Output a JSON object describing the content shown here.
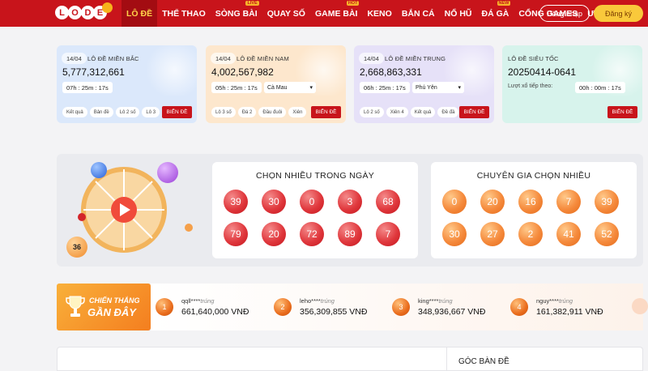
{
  "nav": {
    "logo_letters": [
      "L",
      "O",
      "D",
      "E"
    ],
    "items": [
      {
        "label": "LÔ ĐỀ",
        "active": true,
        "tag": ""
      },
      {
        "label": "THỂ THAO",
        "active": false,
        "tag": ""
      },
      {
        "label": "SÒNG BÀI",
        "active": false,
        "tag": "LIVE"
      },
      {
        "label": "QUAY SỐ",
        "active": false,
        "tag": ""
      },
      {
        "label": "GAME BÀI",
        "active": false,
        "tag": "HOT"
      },
      {
        "label": "KENO",
        "active": false,
        "tag": ""
      },
      {
        "label": "BẮN CÁ",
        "active": false,
        "tag": ""
      },
      {
        "label": "NỔ HŨ",
        "active": false,
        "tag": ""
      },
      {
        "label": "ĐÁ GÀ",
        "active": false,
        "tag": "NEW"
      },
      {
        "label": "CỔNG GAMES",
        "active": false,
        "tag": ""
      },
      {
        "label": "ƯU ĐÃI",
        "active": false,
        "tag": ""
      }
    ],
    "login_label": "Đăng nhập",
    "register_label": "Đăng ký"
  },
  "cards": [
    {
      "date": "14/04",
      "title": "LÔ ĐỀ MIỀN BẮC",
      "amount": "5,777,312,661",
      "timer": "07h : 25m : 17s",
      "select": "",
      "chips": [
        "Kết quả",
        "Bản đề",
        "Lô 2 số",
        "Lô 3"
      ],
      "cta": "BIỂN ĐỀ",
      "bg": "#dbe8fb"
    },
    {
      "date": "14/04",
      "title": "LÔ ĐỀ MIỀN NAM",
      "amount": "4,002,567,982",
      "timer": "05h : 25m : 17s",
      "select": "Cà Mau",
      "chips": [
        "Lô 3 số",
        "Đá 2",
        "Đầu đuôi",
        "Xiên"
      ],
      "cta": "BIỂN ĐỀ",
      "bg": "#fde7cd"
    },
    {
      "date": "14/04",
      "title": "LÔ ĐỀ MIỀN TRUNG",
      "amount": "2,668,863,331",
      "timer": "06h : 25m : 17s",
      "select": "Phú Yên",
      "chips": [
        "Lô 2 số",
        "Xiên 4",
        "Kết quả",
        "Đề đầ"
      ],
      "cta": "BIỂN ĐỀ",
      "bg": "#e6e1f8"
    },
    {
      "date": "",
      "title": "LÔ ĐỀ SIÊU TỐC",
      "amount": "20250414-0641",
      "sub": "Lượt xổ tiếp theo:",
      "timer": "00h : 00m : 17s",
      "select": "",
      "chips": [],
      "cta": "BIỂN ĐỀ",
      "bg": "#d7f3ec"
    }
  ],
  "picks": {
    "left_title": "CHỌN NHIỀU TRONG NGÀY",
    "left_numbers": [
      "39",
      "30",
      "0",
      "3",
      "68",
      "79",
      "20",
      "72",
      "89",
      "7"
    ],
    "right_title": "CHUYÊN GIA CHỌN NHIỀU",
    "right_numbers": [
      "0",
      "20",
      "16",
      "7",
      "39",
      "30",
      "27",
      "2",
      "41",
      "52"
    ],
    "wheel_ball_number": "36"
  },
  "winners": {
    "heading_line1": "CHIẾN THẮNG",
    "heading_line2": "GẦN ĐÂY",
    "list": [
      {
        "rank": "1",
        "name": "qqll****",
        "status": "trúng",
        "amount": "661,640,000 VNĐ"
      },
      {
        "rank": "2",
        "name": "leho****",
        "status": "trúng",
        "amount": "356,309,855 VNĐ"
      },
      {
        "rank": "3",
        "name": "king****",
        "status": "trúng",
        "amount": "348,936,667 VNĐ"
      },
      {
        "rank": "4",
        "name": "nguy****",
        "status": "trúng",
        "amount": "161,382,911 VNĐ"
      }
    ]
  },
  "bottom": {
    "right_title": "GÓC BÀN ĐỀ"
  }
}
